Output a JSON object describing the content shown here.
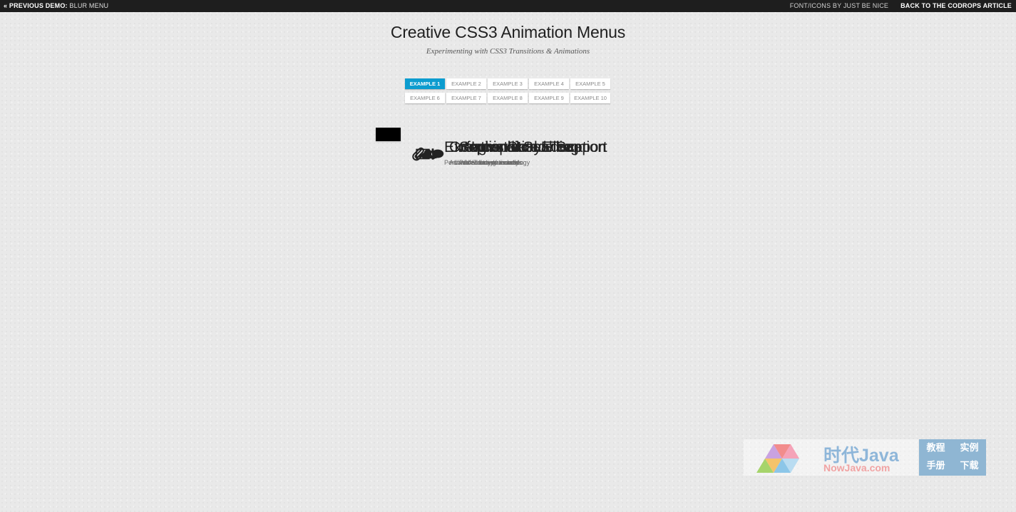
{
  "topbar": {
    "prev_label": "« Previous Demo:",
    "prev_name": "Blur Menu",
    "credit": "Font/Icons by Just Be Nice",
    "back": "Back to the Codrops Article"
  },
  "header": {
    "title": "Creative CSS3 Animation Menus",
    "subtitle": "Experimenting with CSS3 Transitions & Animations"
  },
  "examples": [
    {
      "label": "Example 1",
      "active": true
    },
    {
      "label": "Example 2",
      "active": false
    },
    {
      "label": "Example 3",
      "active": false
    },
    {
      "label": "Example 4",
      "active": false
    },
    {
      "label": "Example 5",
      "active": false
    },
    {
      "label": "Example 6",
      "active": false
    },
    {
      "label": "Example 7",
      "active": false
    },
    {
      "label": "Example 8",
      "active": false
    },
    {
      "label": "Example 9",
      "active": false
    },
    {
      "label": "Example 10",
      "active": false
    }
  ],
  "menu": {
    "items": [
      {
        "title": "Exceptional Service",
        "description": "Personalized to your needs",
        "icon": "paperclip-icon"
      },
      {
        "title": "Creative Storytelling",
        "description": "Advanced use of technology",
        "icon": "image-icon"
      },
      {
        "title": "Infographical Education",
        "description": "Understanding visually",
        "icon": "cloud-icon"
      },
      {
        "title": "Sophisticated Team",
        "description": "Professionals in action",
        "icon": "gear-icon"
      },
      {
        "title": "Unconditional Support",
        "description": "24/7 for you needs",
        "icon": "speech-bubble-icon"
      }
    ]
  },
  "watermark": {
    "name": "时代Java",
    "url": "NowJava.com",
    "tags": [
      "教程",
      "实例",
      "手册",
      "下载"
    ]
  },
  "colors": {
    "accent": "#0c9ccf",
    "menu_border": "#000000",
    "topbar_bg": "#1e1e1e",
    "watermark_blue": "#8fb6d3"
  }
}
